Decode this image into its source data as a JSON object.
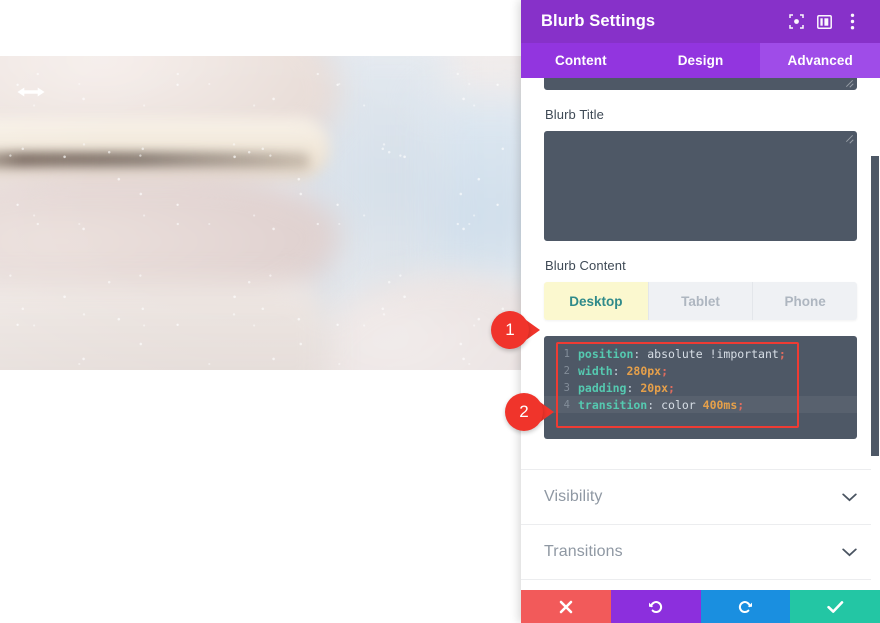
{
  "panel": {
    "title": "Blurb Settings",
    "header_icons": [
      {
        "name": "focus-target-icon",
        "glyph": "target"
      },
      {
        "name": "layout-columns-icon",
        "glyph": "layout"
      },
      {
        "name": "more-options-icon",
        "glyph": "dots"
      }
    ],
    "tabs": [
      {
        "label": "Content",
        "active": false
      },
      {
        "label": "Design",
        "active": false
      },
      {
        "label": "Advanced",
        "active": true
      }
    ],
    "active_tab": "Advanced"
  },
  "fields": {
    "partial_textarea_value": "",
    "blurb_title_label": "Blurb Title",
    "blurb_title_value": "",
    "blurb_content_label": "Blurb Content"
  },
  "device_toggle": {
    "options": [
      {
        "label": "Desktop",
        "active": true
      },
      {
        "label": "Tablet",
        "active": false
      },
      {
        "label": "Phone",
        "active": false
      }
    ],
    "selected": "Desktop"
  },
  "code_editor": {
    "language": "css",
    "active_line": 4,
    "lines": [
      {
        "number": "1",
        "property": "position",
        "colon": ":",
        "value": " absolute",
        "keyword": " !important",
        "number_value": "",
        "semicolon": ";",
        "text": "position: absolute !important;"
      },
      {
        "number": "2",
        "property": "width",
        "colon": ":",
        "value": "",
        "keyword": "",
        "number_value": " 280px",
        "semicolon": ";",
        "text": "width: 280px;"
      },
      {
        "number": "3",
        "property": "padding",
        "colon": ":",
        "value": "",
        "keyword": "",
        "number_value": " 20px",
        "semicolon": ";",
        "text": "padding: 20px;"
      },
      {
        "number": "4",
        "property": "transition",
        "colon": ":",
        "value": " color",
        "keyword": "",
        "number_value": " 400ms",
        "semicolon": ";",
        "text": "transition: color 400ms;"
      }
    ]
  },
  "accordion": {
    "rows": [
      {
        "label": "Visibility"
      },
      {
        "label": "Transitions"
      }
    ]
  },
  "action_bar": {
    "buttons": [
      {
        "name": "cancel-button",
        "icon": "close-icon",
        "color": "#f25a5a"
      },
      {
        "name": "undo-button",
        "icon": "undo-icon",
        "color": "#8c2fdd"
      },
      {
        "name": "redo-button",
        "icon": "redo-icon",
        "color": "#1a8fe0"
      },
      {
        "name": "save-button",
        "icon": "check-icon",
        "color": "#23c6a4"
      }
    ]
  },
  "callouts": [
    {
      "number": "1",
      "target": "device-toggle"
    },
    {
      "number": "2",
      "target": "code-editor"
    }
  ],
  "colors": {
    "header_purple": "#8731c9",
    "tabbar_purple": "#9235df",
    "active_tab_purple": "#9f4ce8",
    "field_slate": "#4e5866",
    "active_device_yellow": "#fbf8cf",
    "active_device_text": "#2f8a8a",
    "annotation_red": "#ef3b33",
    "callout_red": "#f0342b"
  },
  "canvas": {
    "resize_handle": "horizontal-resize-arrow"
  }
}
